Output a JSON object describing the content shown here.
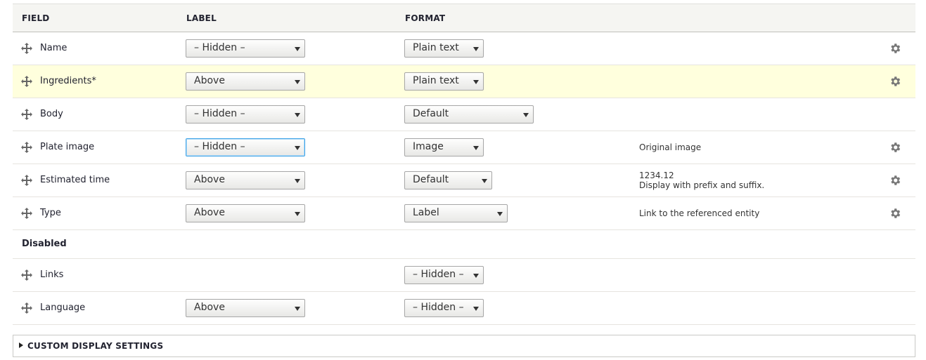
{
  "headers": {
    "field": "FIELD",
    "label": "LABEL",
    "format": "FORMAT"
  },
  "rows": [
    {
      "name": "Name",
      "label": "– Hidden –",
      "format": "Plain text",
      "summary": [],
      "settings": true,
      "highlight": false
    },
    {
      "name": "Ingredients*",
      "label": "Above",
      "format": "Plain text",
      "summary": [],
      "settings": true,
      "highlight": true
    },
    {
      "name": "Body",
      "label": "– Hidden –",
      "format": "Default",
      "summary": [],
      "settings": false,
      "highlight": false
    },
    {
      "name": "Plate image",
      "label": "– Hidden –",
      "format": "Image",
      "summary": [
        "Original image"
      ],
      "settings": true,
      "highlight": false
    },
    {
      "name": "Estimated time",
      "label": "Above",
      "format": "Default",
      "summary": [
        "1234.12",
        "Display with prefix and suffix."
      ],
      "settings": true,
      "highlight": false
    },
    {
      "name": "Type",
      "label": "Above",
      "format": "Label",
      "summary": [
        "Link to the referenced entity"
      ],
      "settings": true,
      "highlight": false
    }
  ],
  "disabled_region": {
    "title": "Disabled",
    "rows": [
      {
        "name": "Links",
        "label": null,
        "format": "– Hidden –"
      },
      {
        "name": "Language",
        "label": "Above",
        "format": "– Hidden –"
      }
    ]
  },
  "custom_display_settings": {
    "label": "CUSTOM DISPLAY SETTINGS",
    "expanded": false
  },
  "colors": {
    "highlight": "#ffffdd",
    "header_bg": "#f5f5f2",
    "focus": "#40a4e8"
  }
}
